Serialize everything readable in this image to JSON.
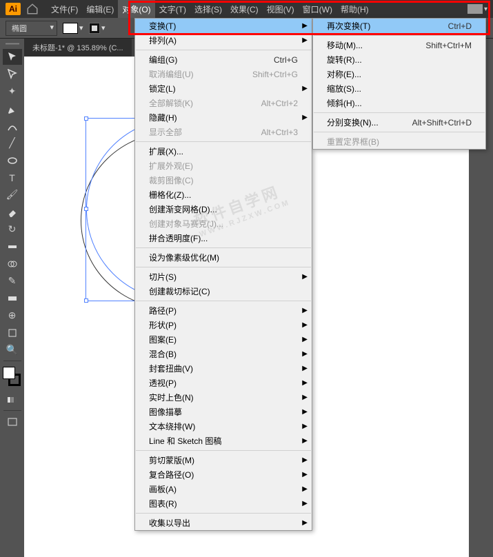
{
  "app": {
    "logo": "Ai"
  },
  "menubar": {
    "items": [
      "文件(F)",
      "编辑(E)",
      "对象(O)",
      "文字(T)",
      "选择(S)",
      "效果(C)",
      "视图(V)",
      "窗口(W)",
      "帮助(H)"
    ],
    "active_index": 2
  },
  "control": {
    "shape": "椭圆"
  },
  "document": {
    "tab": "未标题-1* @ 135.89% (C..."
  },
  "object_menu": {
    "items": [
      {
        "label": "变换(T)",
        "arrow": true,
        "hover": true
      },
      {
        "label": "排列(A)",
        "arrow": true
      },
      {
        "sep": true
      },
      {
        "label": "编组(G)",
        "shortcut": "Ctrl+G"
      },
      {
        "label": "取消编组(U)",
        "shortcut": "Shift+Ctrl+G",
        "disabled": true
      },
      {
        "label": "锁定(L)",
        "arrow": true
      },
      {
        "label": "全部解锁(K)",
        "shortcut": "Alt+Ctrl+2",
        "disabled": true
      },
      {
        "label": "隐藏(H)",
        "arrow": true
      },
      {
        "label": "显示全部",
        "shortcut": "Alt+Ctrl+3",
        "disabled": true
      },
      {
        "sep": true
      },
      {
        "label": "扩展(X)..."
      },
      {
        "label": "扩展外观(E)",
        "disabled": true
      },
      {
        "label": "裁剪图像(C)",
        "disabled": true
      },
      {
        "label": "栅格化(Z)..."
      },
      {
        "label": "创建渐变网格(D)..."
      },
      {
        "label": "创建对象马赛克(J)...",
        "disabled": true
      },
      {
        "label": "拼合透明度(F)..."
      },
      {
        "sep": true
      },
      {
        "label": "设为像素级优化(M)"
      },
      {
        "sep": true
      },
      {
        "label": "切片(S)",
        "arrow": true
      },
      {
        "label": "创建裁切标记(C)"
      },
      {
        "sep": true
      },
      {
        "label": "路径(P)",
        "arrow": true
      },
      {
        "label": "形状(P)",
        "arrow": true
      },
      {
        "label": "图案(E)",
        "arrow": true
      },
      {
        "label": "混合(B)",
        "arrow": true
      },
      {
        "label": "封套扭曲(V)",
        "arrow": true
      },
      {
        "label": "透视(P)",
        "arrow": true
      },
      {
        "label": "实时上色(N)",
        "arrow": true
      },
      {
        "label": "图像描摹",
        "arrow": true
      },
      {
        "label": "文本绕排(W)",
        "arrow": true
      },
      {
        "label": "Line 和 Sketch 图稿",
        "arrow": true
      },
      {
        "sep": true
      },
      {
        "label": "剪切蒙版(M)",
        "arrow": true
      },
      {
        "label": "复合路径(O)",
        "arrow": true
      },
      {
        "label": "画板(A)",
        "arrow": true
      },
      {
        "label": "图表(R)",
        "arrow": true
      },
      {
        "sep": true
      },
      {
        "label": "收集以导出",
        "arrow": true
      }
    ]
  },
  "transform_submenu": {
    "items": [
      {
        "label": "再次变换(T)",
        "shortcut": "Ctrl+D",
        "hover": true
      },
      {
        "sep": true
      },
      {
        "label": "移动(M)...",
        "shortcut": "Shift+Ctrl+M"
      },
      {
        "label": "旋转(R)..."
      },
      {
        "label": "对称(E)..."
      },
      {
        "label": "缩放(S)..."
      },
      {
        "label": "倾斜(H)..."
      },
      {
        "sep": true
      },
      {
        "label": "分别变换(N)...",
        "shortcut": "Alt+Shift+Ctrl+D"
      },
      {
        "sep": true
      },
      {
        "label": "重置定界框(B)",
        "disabled": true
      }
    ]
  },
  "watermark": {
    "main": "软件自学网",
    "sub": "WWW.RJZXW.COM"
  }
}
